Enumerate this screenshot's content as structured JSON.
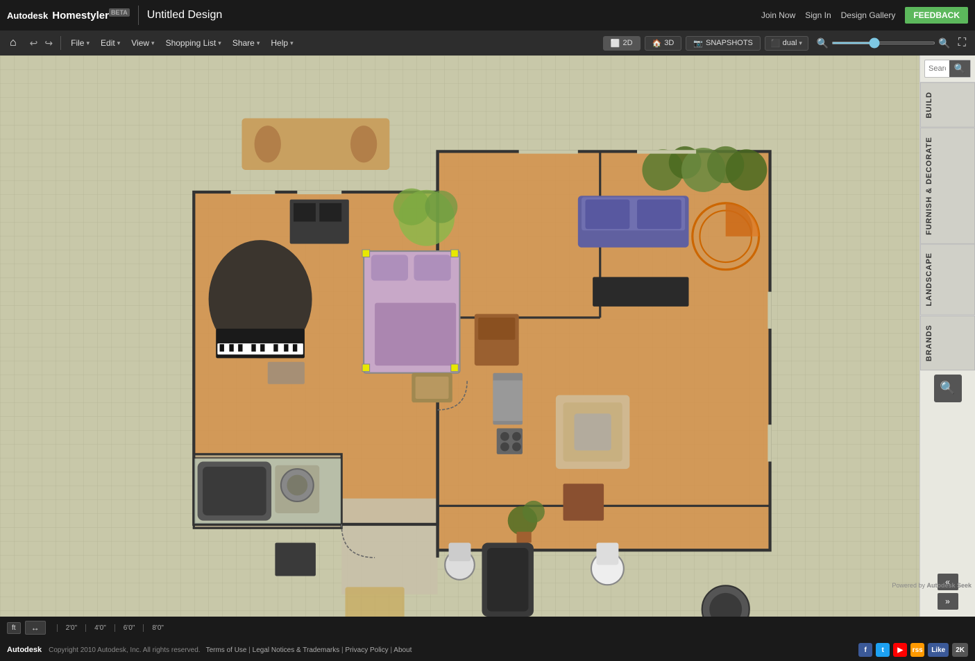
{
  "topbar": {
    "autodesk": "Autodesk",
    "homestyler": "Homestyler",
    "beta": "BETA",
    "title": "Untitled Design",
    "join_now": "Join Now",
    "sign_in": "Sign In",
    "design_gallery": "Design Gallery",
    "feedback": "FEEDBACK"
  },
  "menubar": {
    "file": "File",
    "edit": "Edit",
    "view": "View",
    "shopping_list": "Shopping List",
    "share": "Share",
    "help": "Help",
    "view_2d": "2D",
    "view_3d": "3D",
    "snapshots": "SNAPSHOTS",
    "dual": "dual"
  },
  "sidebar": {
    "search_placeholder": "Search...",
    "tabs": [
      "BUILD",
      "FURNISH & DECORATE",
      "LANDSCAPE",
      "BRANDS"
    ],
    "search_btn": "🔍"
  },
  "bottombar": {
    "unit": "ft",
    "measure": "↔",
    "scale_marks": [
      "2'0\"",
      "4'0\"",
      "6'0\"",
      "8'0\""
    ],
    "powered_by": "Powered by",
    "autodesk_seek": "Autodesk Seek"
  },
  "footer": {
    "autodesk": "Autodesk",
    "copyright": "Copyright 2010 Autodesk, Inc. All rights reserved.",
    "terms": "Terms of Use",
    "legal": "Legal Notices & Trademarks",
    "privacy": "Privacy Policy",
    "about": "About",
    "like": "Like",
    "count_2k": "2K"
  }
}
